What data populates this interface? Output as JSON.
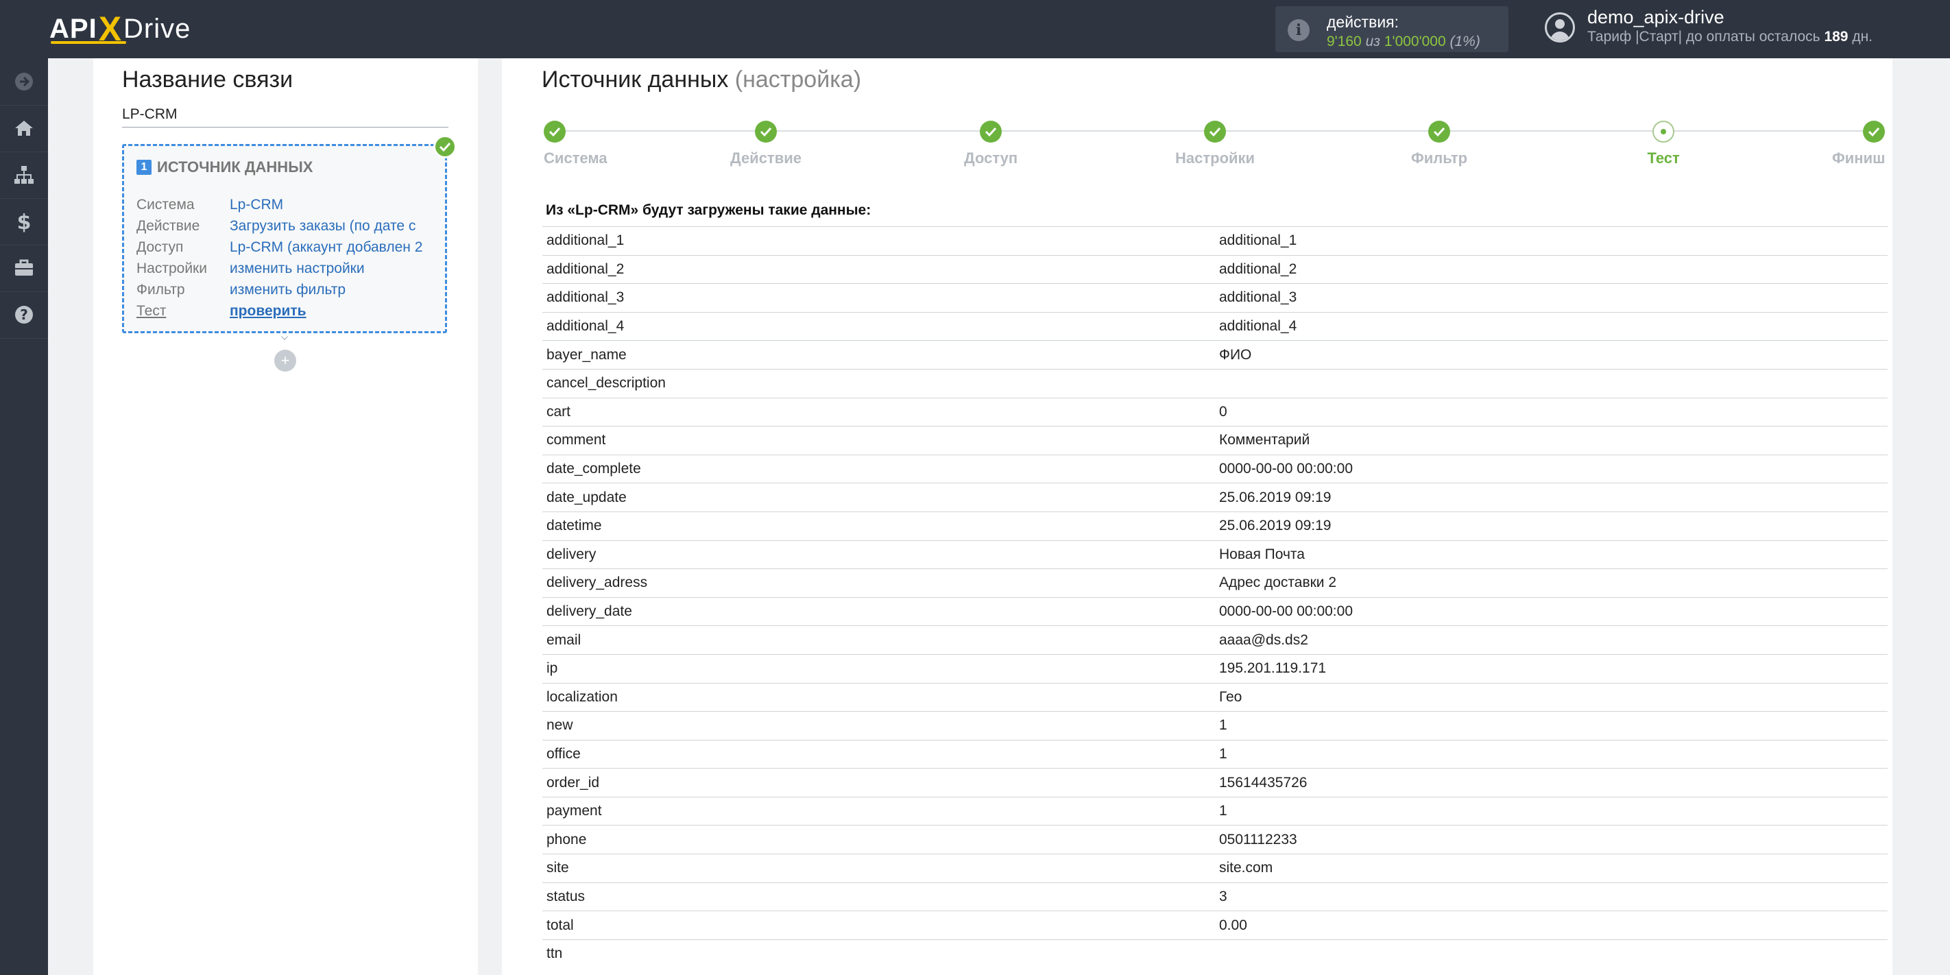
{
  "brand": {
    "api": "API",
    "x": "X",
    "drive": "Drive"
  },
  "actions": {
    "label": "действия:",
    "used": "9'160",
    "of": "из",
    "total": "1'000'000",
    "pct": "(1%)"
  },
  "user": {
    "name": "demo_apix-drive",
    "plan_prefix": "Тариф |Старт| до оплаты осталось",
    "days": "189",
    "days_suffix": "дн."
  },
  "rail_icons": [
    "arrow-right-icon",
    "home-icon",
    "sitemap-icon",
    "dollar-icon",
    "briefcase-icon",
    "question-icon"
  ],
  "left": {
    "title": "Название связи",
    "connection_name": "LP-CRM",
    "card": {
      "num": "1",
      "title": "ИСТОЧНИК ДАННЫХ",
      "rows": [
        {
          "k": "Система",
          "v": "Lp-CRM"
        },
        {
          "k": "Действие",
          "v": "Загрузить заказы (по дате с"
        },
        {
          "k": "Доступ",
          "v": "Lp-CRM (аккаунт добавлен 2"
        },
        {
          "k": "Настройки",
          "v": "изменить настройки"
        },
        {
          "k": "Фильтр",
          "v": "изменить фильтр"
        },
        {
          "k": "Тест",
          "v": "проверить"
        }
      ]
    },
    "add": "+"
  },
  "main": {
    "title": "Источник данных",
    "title_sub": "(настройка)",
    "steps": [
      {
        "label": "Система",
        "state": "done"
      },
      {
        "label": "Действие",
        "state": "done"
      },
      {
        "label": "Доступ",
        "state": "done"
      },
      {
        "label": "Настройки",
        "state": "done"
      },
      {
        "label": "Фильтр",
        "state": "done"
      },
      {
        "label": "Тест",
        "state": "current"
      },
      {
        "label": "Финиш",
        "state": "done"
      }
    ],
    "data_header": "Из «Lp-CRM» будут загружены такие данные:",
    "rows": [
      {
        "k": "additional_1",
        "v": "additional_1"
      },
      {
        "k": "additional_2",
        "v": "additional_2"
      },
      {
        "k": "additional_3",
        "v": "additional_3"
      },
      {
        "k": "additional_4",
        "v": "additional_4"
      },
      {
        "k": "bayer_name",
        "v": "ФИО"
      },
      {
        "k": "cancel_description",
        "v": ""
      },
      {
        "k": "cart",
        "v": "0"
      },
      {
        "k": "comment",
        "v": "Комментарий"
      },
      {
        "k": "date_complete",
        "v": "0000-00-00 00:00:00"
      },
      {
        "k": "date_update",
        "v": "25.06.2019 09:19"
      },
      {
        "k": "datetime",
        "v": "25.06.2019 09:19"
      },
      {
        "k": "delivery",
        "v": "Новая Почта"
      },
      {
        "k": "delivery_adress",
        "v": "Адрес доставки 2"
      },
      {
        "k": "delivery_date",
        "v": "0000-00-00 00:00:00"
      },
      {
        "k": "email",
        "v": "aaaa@ds.ds2"
      },
      {
        "k": "ip",
        "v": "195.201.119.171"
      },
      {
        "k": "localization",
        "v": "Гео"
      },
      {
        "k": "new",
        "v": "1"
      },
      {
        "k": "office",
        "v": "1"
      },
      {
        "k": "order_id",
        "v": "15614435726"
      },
      {
        "k": "payment",
        "v": "1"
      },
      {
        "k": "phone",
        "v": "0501112233"
      },
      {
        "k": "site",
        "v": "site.com"
      },
      {
        "k": "status",
        "v": "3"
      },
      {
        "k": "total",
        "v": "0.00"
      },
      {
        "k": "ttn",
        "v": ""
      }
    ]
  }
}
